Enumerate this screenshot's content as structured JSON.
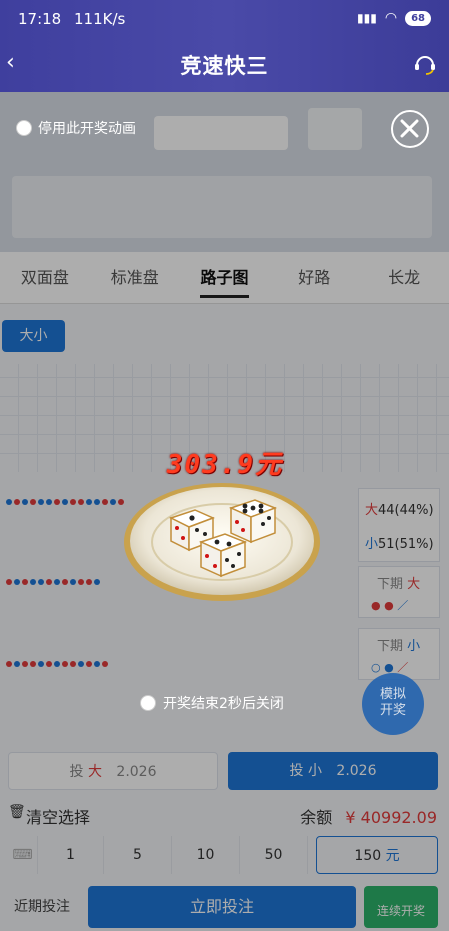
{
  "status": {
    "time": "17:18",
    "speed": "111K/s",
    "battery": "68"
  },
  "header": {
    "title": "竞速快三"
  },
  "tabs": [
    "双面盘",
    "标准盘",
    "路子图",
    "好路",
    "长龙"
  ],
  "active_tab": "路子图",
  "chip_label": "大小",
  "stats": {
    "big": {
      "label": "大",
      "value": "44(44%)"
    },
    "small": {
      "label": "小",
      "value": "51(51%)"
    },
    "next_big": {
      "label": "下期",
      "tag": "大"
    },
    "next_small": {
      "label": "下期",
      "tag": "小"
    }
  },
  "bets": {
    "big": {
      "label": "投",
      "tag": "大",
      "odds": "2.026"
    },
    "small": {
      "label": "投 小",
      "odds": "2.026"
    }
  },
  "clear_label": "清空选择",
  "balance": {
    "label": "余额",
    "currency": "¥",
    "value": "40992.09"
  },
  "chips": [
    "1",
    "5",
    "10",
    "50"
  ],
  "custom_amount": {
    "value": "150",
    "unit": "元"
  },
  "actions": {
    "recent": "近期投注",
    "bet_now": "立即投注",
    "continuous": "连续开奖"
  },
  "overlay": {
    "disable_anim_label": "停用此开奖动画",
    "amount": "303.9元",
    "closing_notice": "开奖结束2秒后关闭",
    "simulate_label": "模拟\n开奖"
  },
  "colors": {
    "header": "#3f3f9e",
    "primary": "#1e77d8",
    "red": "#e23b3b",
    "blue": "#1e77d8",
    "green": "#2db36b"
  }
}
